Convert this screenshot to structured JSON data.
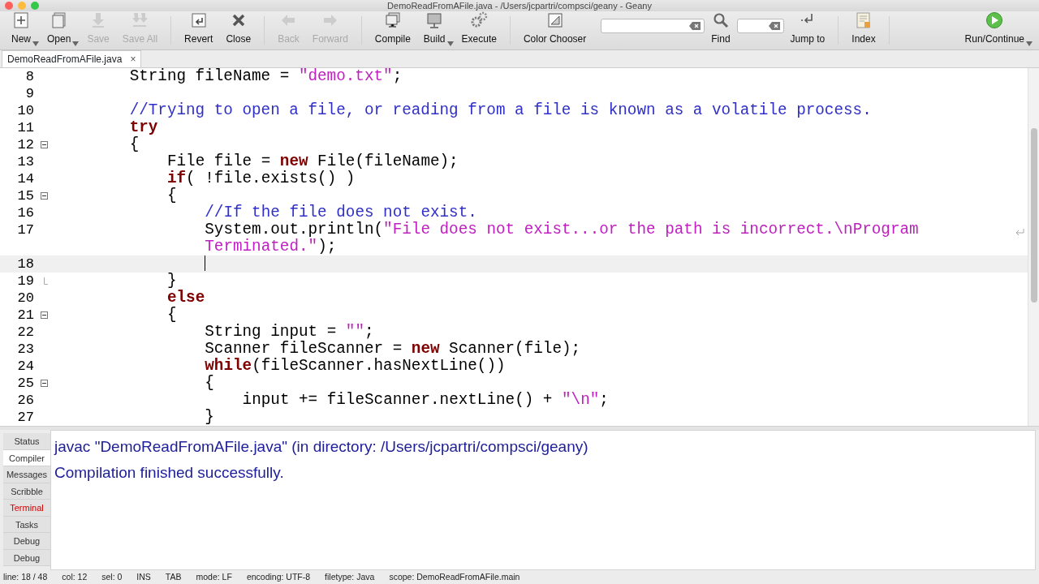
{
  "window": {
    "title": "DemoReadFromAFile.java - /Users/jcpartri/compsci/geany - Geany"
  },
  "toolbar": [
    {
      "kind": "button",
      "label": "New",
      "disabled": false,
      "dropdown": true
    },
    {
      "kind": "button",
      "label": "Open",
      "disabled": false,
      "dropdown": true
    },
    {
      "kind": "button",
      "label": "Save",
      "disabled": true,
      "dropdown": false
    },
    {
      "kind": "button",
      "label": "Save All",
      "disabled": true,
      "dropdown": false
    },
    {
      "kind": "separator"
    },
    {
      "kind": "button",
      "label": "Revert",
      "disabled": false,
      "dropdown": false
    },
    {
      "kind": "button",
      "label": "Close",
      "disabled": false,
      "dropdown": false
    },
    {
      "kind": "separator"
    },
    {
      "kind": "button",
      "label": "Back",
      "disabled": true,
      "dropdown": false
    },
    {
      "kind": "button",
      "label": "Forward",
      "disabled": true,
      "dropdown": false
    },
    {
      "kind": "separator"
    },
    {
      "kind": "button",
      "label": "Compile",
      "disabled": false,
      "dropdown": false
    },
    {
      "kind": "button",
      "label": "Build",
      "disabled": false,
      "dropdown": true
    },
    {
      "kind": "button",
      "label": "Execute",
      "disabled": false,
      "dropdown": false
    },
    {
      "kind": "separator"
    },
    {
      "kind": "button",
      "label": "Color Chooser",
      "disabled": false,
      "dropdown": false
    },
    {
      "kind": "field"
    },
    {
      "kind": "button",
      "label": "Find",
      "disabled": false,
      "dropdown": false
    },
    {
      "kind": "field"
    },
    {
      "kind": "button",
      "label": "Jump to",
      "disabled": false,
      "dropdown": false
    },
    {
      "kind": "separator"
    },
    {
      "kind": "button",
      "label": "Index",
      "disabled": false,
      "dropdown": false
    },
    {
      "kind": "separator"
    },
    {
      "kind": "button",
      "label": "Run/Continue",
      "disabled": false,
      "dropdown": true
    }
  ],
  "tabs": [
    {
      "label": "DemoReadFromAFile.java",
      "selected": true,
      "close": "×"
    }
  ],
  "editor": {
    "lines": [
      {
        "number": "8",
        "current": false,
        "wrapped": false,
        "tokens": [
          {
            "kind": "plain",
            "text": "        String fileName = "
          },
          {
            "kind": "string",
            "text": "\"demo.txt\""
          },
          {
            "kind": "plain",
            "text": ";"
          }
        ]
      },
      {
        "number": "9",
        "current": false,
        "wrapped": false
      },
      {
        "number": "10",
        "current": false,
        "wrapped": false,
        "tokens": [
          {
            "kind": "comment",
            "text": "        //Trying to open a file, or reading from a file is known as a volatile process."
          }
        ]
      },
      {
        "number": "11",
        "current": false,
        "wrapped": false,
        "tokens": [
          {
            "kind": "keyword",
            "text": "        try"
          }
        ]
      },
      {
        "number": "12",
        "current": false,
        "wrapped": false,
        "kind": "fold_start",
        "tokens": [
          {
            "kind": "plain",
            "text": "        {"
          }
        ]
      },
      {
        "number": "13",
        "current": false,
        "wrapped": false,
        "tokens": [
          {
            "kind": "plain",
            "text": "            File file = "
          },
          {
            "kind": "keyword",
            "text": "new"
          },
          {
            "kind": "plain",
            "text": " File(fileName);"
          }
        ]
      },
      {
        "number": "14",
        "current": false,
        "wrapped": false,
        "tokens": [
          {
            "kind": "keyword",
            "text": "            if"
          },
          {
            "kind": "plain",
            "text": "( !file.exists() )"
          }
        ]
      },
      {
        "number": "15",
        "current": false,
        "wrapped": false,
        "kind": "fold_start",
        "tokens": [
          {
            "kind": "plain",
            "text": "            {"
          }
        ]
      },
      {
        "number": "16",
        "current": false,
        "wrapped": false,
        "tokens": [
          {
            "kind": "comment",
            "text": "                //If the file does not exist."
          }
        ]
      },
      {
        "number": "17",
        "current": false,
        "wrapped": true,
        "tokens": [
          {
            "kind": "plain",
            "text": "                System.out.println("
          },
          {
            "kind": "string",
            "text": "\"File does not exist...or the path is incorrect.\\nProgram Terminated.\""
          },
          {
            "kind": "plain",
            "text": ");"
          }
        ]
      },
      {
        "number": "18",
        "current": true,
        "wrapped": false
      },
      {
        "number": "19",
        "current": false,
        "wrapped": false,
        "kind": "fold_end",
        "tokens": [
          {
            "kind": "plain",
            "text": "            }"
          }
        ]
      },
      {
        "number": "20",
        "current": false,
        "wrapped": false,
        "tokens": [
          {
            "kind": "keyword",
            "text": "            else"
          }
        ]
      },
      {
        "number": "21",
        "current": false,
        "wrapped": false,
        "kind": "fold_start",
        "tokens": [
          {
            "kind": "plain",
            "text": "            {"
          }
        ]
      },
      {
        "number": "22",
        "current": false,
        "wrapped": false,
        "tokens": [
          {
            "kind": "plain",
            "text": "                String input = "
          },
          {
            "kind": "string",
            "text": "\"\""
          },
          {
            "kind": "plain",
            "text": ";"
          }
        ]
      },
      {
        "number": "23",
        "current": false,
        "wrapped": false,
        "tokens": [
          {
            "kind": "plain",
            "text": "                Scanner fileScanner = "
          },
          {
            "kind": "keyword",
            "text": "new"
          },
          {
            "kind": "plain",
            "text": " Scanner(file);"
          }
        ]
      },
      {
        "number": "24",
        "current": false,
        "wrapped": false,
        "tokens": [
          {
            "kind": "keyword",
            "text": "                while"
          },
          {
            "kind": "plain",
            "text": "(fileScanner.hasNextLine())"
          }
        ]
      },
      {
        "number": "25",
        "current": false,
        "wrapped": false,
        "kind": "fold_start",
        "tokens": [
          {
            "kind": "plain",
            "text": "                {"
          }
        ]
      },
      {
        "number": "26",
        "current": false,
        "wrapped": false,
        "tokens": [
          {
            "kind": "plain",
            "text": "                    input += fileScanner.nextLine() + "
          },
          {
            "kind": "string",
            "text": "\"\\n\""
          },
          {
            "kind": "plain",
            "text": ";"
          }
        ]
      },
      {
        "number": "27",
        "current": false,
        "wrapped": false,
        "tokens": [
          {
            "kind": "plain",
            "text": "                }"
          }
        ]
      }
    ]
  },
  "message_tabs": [
    {
      "label": "Status",
      "selected": false,
      "color": "#333333"
    },
    {
      "label": "Compiler",
      "selected": true,
      "color": "#333333"
    },
    {
      "label": "Messages",
      "selected": false,
      "color": "#333333"
    },
    {
      "label": "Scribble",
      "selected": false,
      "color": "#333333"
    },
    {
      "label": "Terminal",
      "selected": false,
      "color": "#cc0000"
    },
    {
      "label": "Tasks",
      "selected": false,
      "color": "#333333"
    },
    {
      "label": "Debug",
      "selected": false,
      "color": "#333333"
    },
    {
      "label": "Debug",
      "selected": false,
      "color": "#333333"
    }
  ],
  "compiler_output": [
    "javac \"DemoReadFromAFile.java\" (in directory: /Users/jcpartri/compsci/geany)",
    "Compilation finished successfully."
  ],
  "status_bar": [
    "line: 18 / 48",
    "col: 12",
    "sel: 0",
    "INS",
    "TAB",
    "mode: LF",
    "encoding: UTF-8",
    "filetype: Java",
    "scope: DemoReadFromAFile.main"
  ]
}
